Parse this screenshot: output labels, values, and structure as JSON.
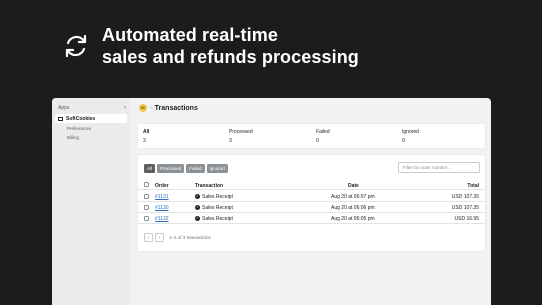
{
  "hero": {
    "line1": "Automated real-time",
    "line2": "sales and refunds processing",
    "icon": "sync-icon"
  },
  "sidebar": {
    "apps_label": "Apps",
    "app_name": "SoftCookies",
    "items": [
      {
        "label": "Preferences"
      },
      {
        "label": "Billing"
      }
    ]
  },
  "header": {
    "logo_text": "SC",
    "separator": "›",
    "title": "Transactions"
  },
  "stats": [
    {
      "label": "All",
      "value": "3"
    },
    {
      "label": "Processed",
      "value": "3"
    },
    {
      "label": "Failed",
      "value": "0"
    },
    {
      "label": "Ignored",
      "value": "0"
    }
  ],
  "filters": {
    "chips": [
      {
        "label": "All"
      },
      {
        "label": "Processed"
      },
      {
        "label": "Failed"
      },
      {
        "label": "Ignored"
      }
    ],
    "search_placeholder": "Filter by order number..."
  },
  "table": {
    "columns": {
      "order": "Order",
      "type": "Transaction",
      "date": "Date",
      "total": "Total"
    },
    "rows": [
      {
        "order": "#1131",
        "type": "Sales Receipt",
        "date": "Aug 20 at 06:07 pm",
        "total": "USD 107.35"
      },
      {
        "order": "#1130",
        "type": "Sales Receipt",
        "date": "Aug 20 at 06:06 pm",
        "total": "USD 107.35"
      },
      {
        "order": "#1132",
        "type": "Sales Receipt",
        "date": "Aug 20 at 06:05 pm",
        "total": "USD 16.95"
      }
    ]
  },
  "pagination": {
    "prev": "‹",
    "next": "›",
    "info": "1–3 of 3 transactions"
  },
  "colors": {
    "background": "#1c1c1c",
    "accent": "#f2c94c",
    "link": "#2c6ecb"
  }
}
